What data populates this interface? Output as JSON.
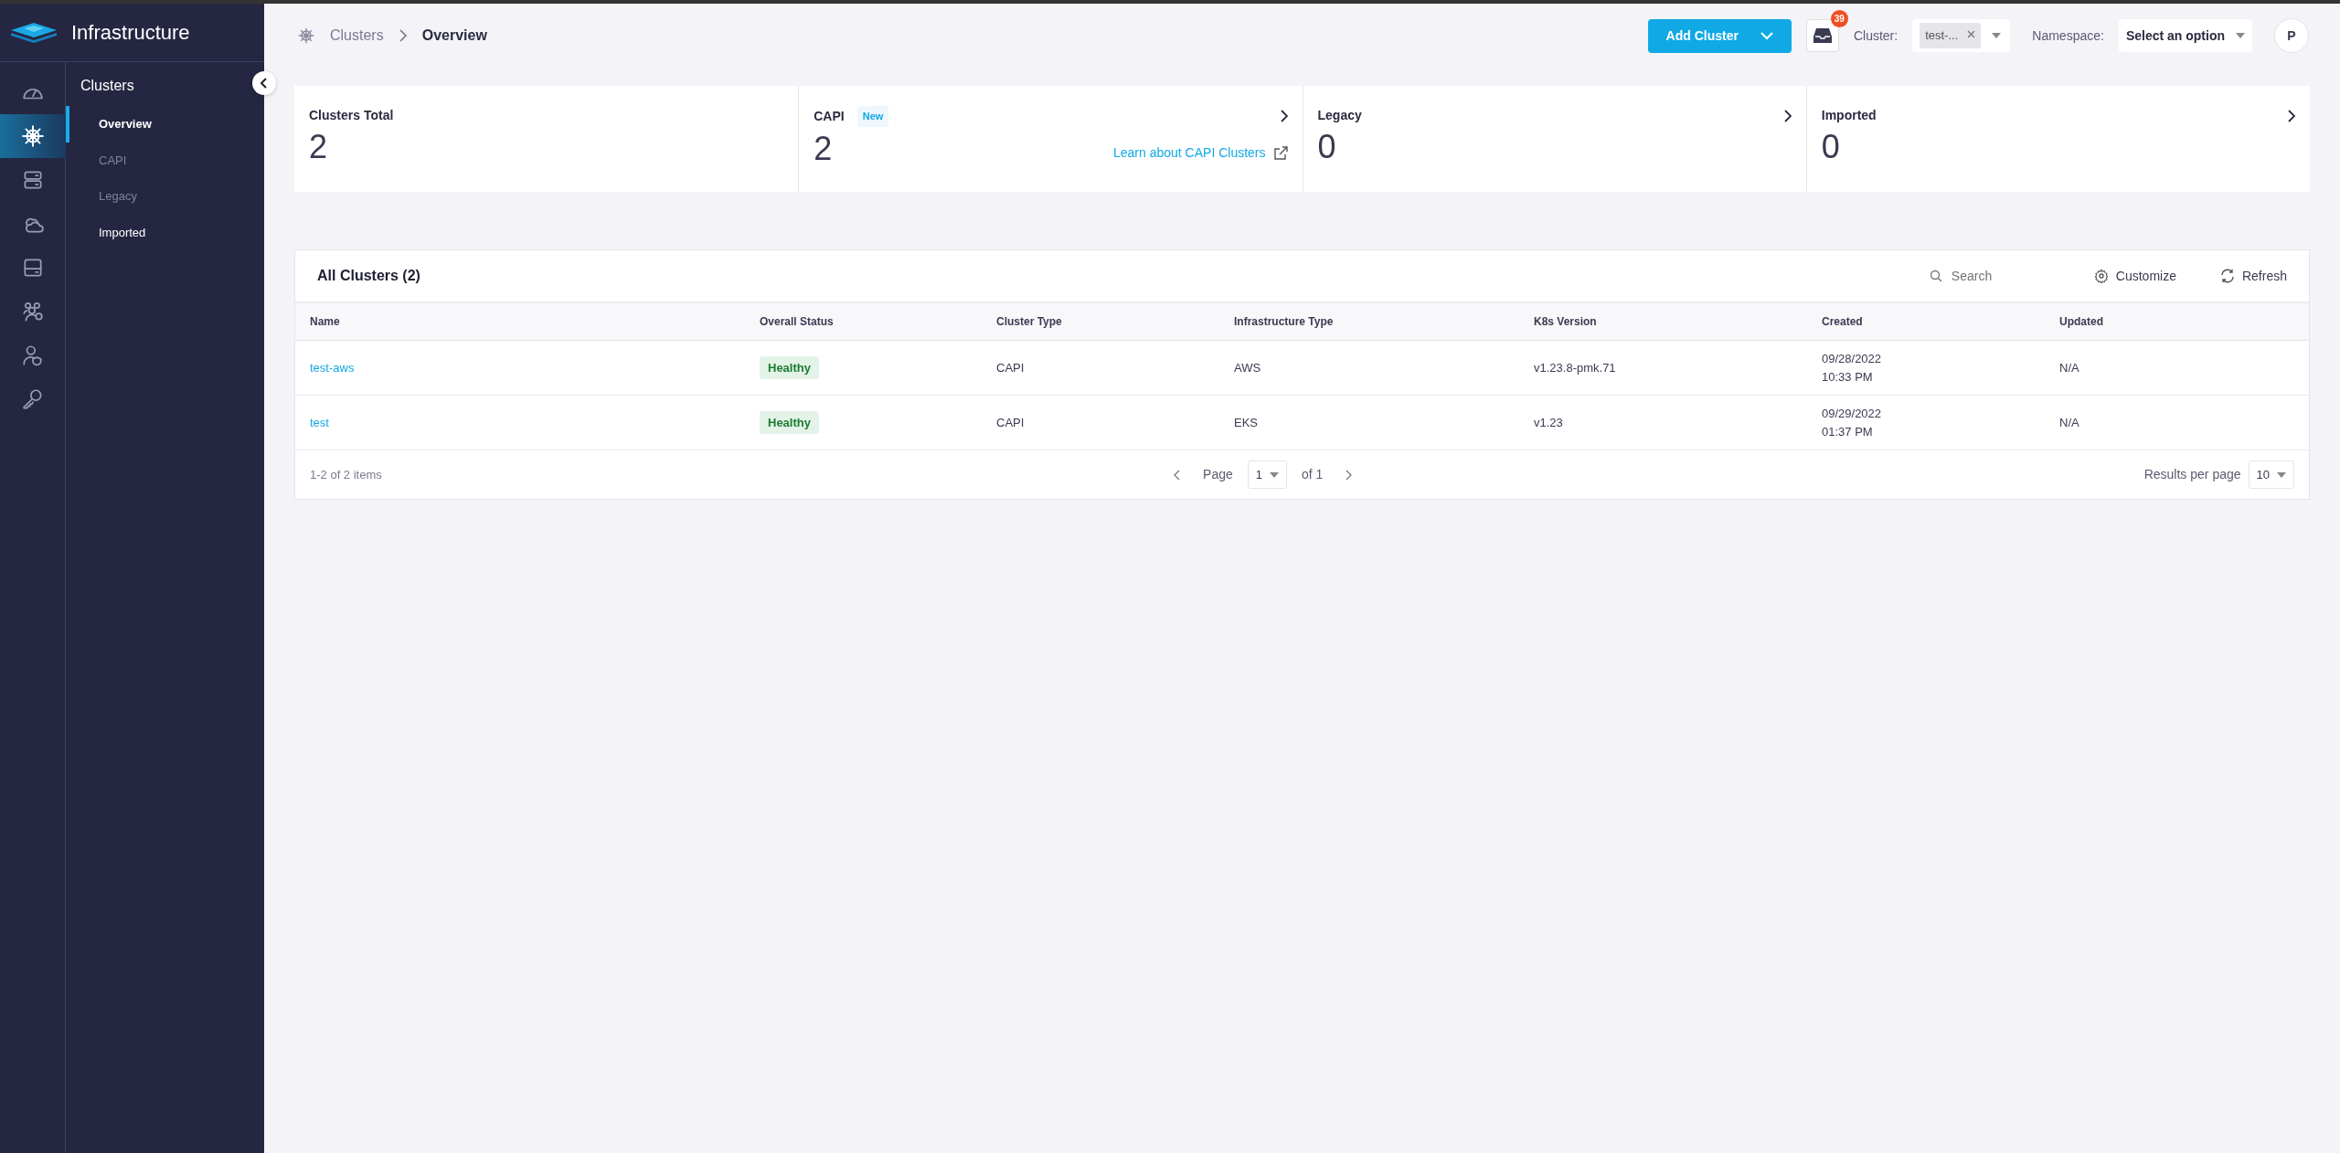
{
  "brand": {
    "title": "Infrastructure"
  },
  "rail": [
    {
      "selected": false
    },
    {
      "selected": true
    },
    {
      "selected": false
    },
    {
      "selected": false
    },
    {
      "selected": false
    },
    {
      "selected": false
    },
    {
      "selected": false
    },
    {
      "selected": false
    }
  ],
  "subnav": {
    "title": "Clusters",
    "items": [
      {
        "label": "Overview",
        "selected": true,
        "disabled": false
      },
      {
        "label": "CAPI",
        "selected": false,
        "disabled": true
      },
      {
        "label": "Legacy",
        "selected": false,
        "disabled": true
      },
      {
        "label": "Imported",
        "selected": false,
        "disabled": false
      }
    ]
  },
  "breadcrumb": [
    "Clusters",
    "Overview"
  ],
  "header": {
    "add_button": "Add Cluster",
    "notifications": "39",
    "cluster_label": "Cluster:",
    "cluster_chip": "test-...",
    "namespace_label": "Namespace:",
    "namespace_value": "Select an option",
    "avatar": "P"
  },
  "cards": [
    {
      "title": "Clusters Total",
      "value": "2",
      "navigable": false
    },
    {
      "title": "CAPI",
      "badge": "New",
      "value": "2",
      "link": "Learn about CAPI Clusters",
      "navigable": true
    },
    {
      "title": "Legacy",
      "value": "0",
      "navigable": true
    },
    {
      "title": "Imported",
      "value": "0",
      "navigable": true
    }
  ],
  "table": {
    "title": "All Clusters (2)",
    "search_placeholder": "Search",
    "customize": "Customize",
    "refresh": "Refresh",
    "columns": [
      "Name",
      "Overall Status",
      "Cluster Type",
      "Infrastructure Type",
      "K8s Version",
      "Created",
      "Updated"
    ],
    "rows": [
      {
        "name": "test-aws",
        "status": "Healthy",
        "cluster_type": "CAPI",
        "infrastructure_type": "AWS",
        "k8s_version": "v1.23.8-pmk.71",
        "created": [
          "09/28/2022",
          "10:33 PM"
        ],
        "updated": "N/A"
      },
      {
        "name": "test",
        "status": "Healthy",
        "cluster_type": "CAPI",
        "infrastructure_type": "EKS",
        "k8s_version": "v1.23",
        "created": [
          "09/29/2022",
          "01:37 PM"
        ],
        "updated": "N/A"
      }
    ],
    "footer": {
      "items": "1-2 of 2 items",
      "page_label": "Page",
      "page": "1",
      "of_pages": "of 1",
      "per_page_label": "Results per page",
      "per_page": "10"
    }
  }
}
